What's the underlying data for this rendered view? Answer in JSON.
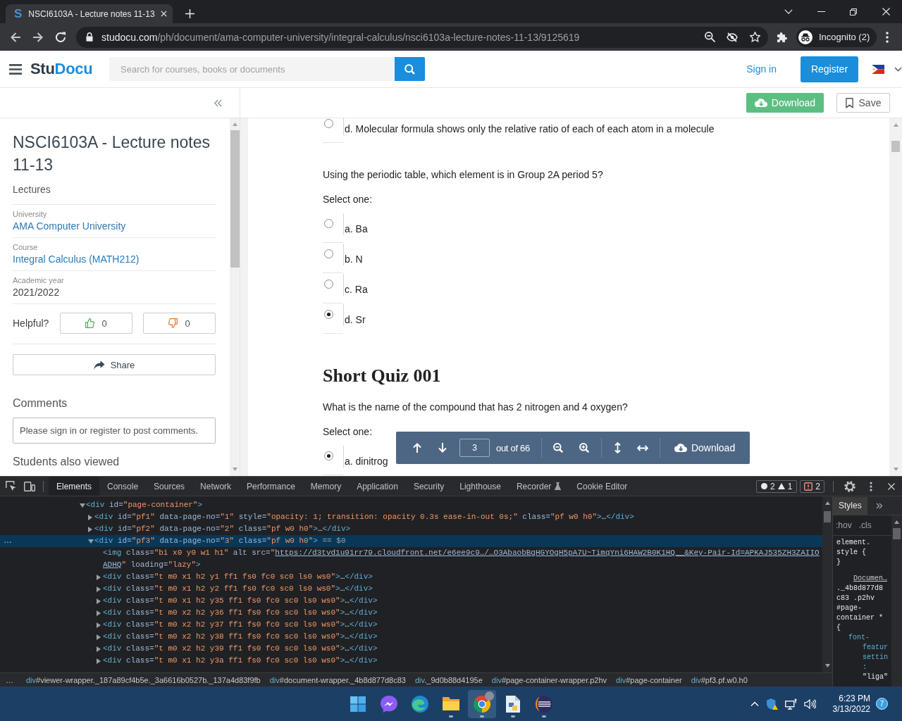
{
  "browser": {
    "tab": {
      "favicon": "S",
      "title": "NSCI6103A - Lecture notes 11-13",
      "selected": true
    },
    "url": {
      "host": "studocu.com",
      "path": "/ph/document/ama-computer-university/integral-calculus/nsci6103a-lecture-notes-11-13/9125619"
    },
    "profile": {
      "label": "Incognito (2)"
    }
  },
  "site_header": {
    "logo": {
      "text": "Stu",
      "highlight": "Docu"
    },
    "search": {
      "placeholder": "Search for courses, books or documents"
    },
    "sign_in": "Sign in",
    "register": "Register"
  },
  "action_bar": {
    "download": "Download",
    "save": "Save"
  },
  "sidebar": {
    "title": "NSCI6103A - Lecture notes 11-13",
    "category": "Lectures",
    "details": [
      {
        "label": "University",
        "value": "AMA Computer University",
        "kind": "link"
      },
      {
        "label": "Course",
        "value": "Integral Calculus (MATH212)",
        "kind": "link"
      },
      {
        "label": "Academic year",
        "value": "2021/2022",
        "kind": "text"
      }
    ],
    "helpful": {
      "label": "Helpful?",
      "votes": [
        {
          "kind": "up",
          "count": "0"
        },
        {
          "kind": "down",
          "count": "0"
        }
      ]
    },
    "share": "Share",
    "comments": {
      "heading": "Comments",
      "notice": "Please sign in or register to post comments."
    },
    "related_heading": "Students also viewed"
  },
  "document": {
    "items": [
      {
        "kind": "option",
        "label": "d. Molecular formula shows only the relative ratio of each of each atom in a molecule",
        "selected": false
      },
      {
        "kind": "question",
        "text": "Using the periodic table, which element is in Group 2A period 5?"
      },
      {
        "kind": "prompt",
        "text": "Select one:"
      },
      {
        "kind": "option",
        "label": "a. Ba",
        "selected": false
      },
      {
        "kind": "option",
        "label": "b. N",
        "selected": false
      },
      {
        "kind": "option",
        "label": "c. Ra",
        "selected": false
      },
      {
        "kind": "option",
        "label": "d. Sr",
        "selected": true
      },
      {
        "kind": "heading",
        "text": "Short Quiz 001"
      },
      {
        "kind": "question",
        "text": "What is the name of the compound that has 2 nitrogen and 4 oxygen?"
      },
      {
        "kind": "prompt",
        "text": "Select one:"
      },
      {
        "kind": "option",
        "label": "a. dinitrog",
        "selected": true
      }
    ]
  },
  "viewer_toolbar": {
    "page": "3",
    "total": "out of 66",
    "download": "Download"
  },
  "devtools": {
    "tabs": [
      {
        "label": "Elements",
        "selected": true,
        "kind": "panel"
      },
      {
        "label": "Console",
        "selected": false,
        "kind": "panel"
      },
      {
        "label": "Sources",
        "selected": false,
        "kind": "panel"
      },
      {
        "label": "Network",
        "selected": false,
        "kind": "panel"
      },
      {
        "label": "Performance",
        "selected": false,
        "kind": "panel"
      },
      {
        "label": "Memory",
        "selected": false,
        "kind": "panel"
      },
      {
        "label": "Application",
        "selected": false,
        "kind": "panel"
      },
      {
        "label": "Security",
        "selected": false,
        "kind": "panel"
      },
      {
        "label": "Lighthouse",
        "selected": false,
        "kind": "panel"
      },
      {
        "label": "Recorder",
        "selected": false,
        "kind": "preview"
      },
      {
        "label": "Cookie Editor",
        "selected": false,
        "kind": "panel"
      }
    ],
    "counters": [
      {
        "kind": "error",
        "count": "2"
      },
      {
        "kind": "warning",
        "count": "1"
      }
    ],
    "issues": "2",
    "tree": [
      {
        "kind": "parent",
        "expanded": true,
        "selected": false,
        "tokens": [
          {
            "kind": "tag",
            "text": "<div"
          },
          {
            "kind": "attr",
            "text": " id="
          },
          {
            "kind": "value",
            "text": "\"page-container\""
          },
          {
            "kind": "tag",
            "text": ">"
          }
        ],
        "children": [
          {
            "kind": "parent",
            "expanded": false,
            "selected": false,
            "tokens": [
              {
                "kind": "tag",
                "text": "<div"
              },
              {
                "kind": "attr",
                "text": " id="
              },
              {
                "kind": "value",
                "text": "\"pf1\""
              },
              {
                "kind": "attr",
                "text": " data-page-no="
              },
              {
                "kind": "value",
                "text": "\"1\""
              },
              {
                "kind": "attr",
                "text": " style="
              },
              {
                "kind": "value",
                "text": "\"opacity: 1; transition: opacity 0.3s ease-in-out 0s;\""
              },
              {
                "kind": "attr",
                "text": " class="
              },
              {
                "kind": "value",
                "text": "\"pf w0 h0\""
              },
              {
                "kind": "tag",
                "text": ">"
              },
              {
                "kind": "plain",
                "text": "…"
              },
              {
                "kind": "tag",
                "text": "</div>"
              }
            ]
          },
          {
            "kind": "parent",
            "expanded": false,
            "selected": false,
            "tokens": [
              {
                "kind": "tag",
                "text": "<div"
              },
              {
                "kind": "attr",
                "text": " id="
              },
              {
                "kind": "value",
                "text": "\"pf2\""
              },
              {
                "kind": "attr",
                "text": " data-page-no="
              },
              {
                "kind": "value",
                "text": "\"2\""
              },
              {
                "kind": "attr",
                "text": " class="
              },
              {
                "kind": "value",
                "text": "\"pf w0 h0\""
              },
              {
                "kind": "tag",
                "text": ">"
              },
              {
                "kind": "plain",
                "text": "…"
              },
              {
                "kind": "tag",
                "text": "</div>"
              }
            ]
          },
          {
            "kind": "parent",
            "expanded": true,
            "selected": true,
            "marker": "…",
            "tokens": [
              {
                "kind": "tag",
                "text": "<div"
              },
              {
                "kind": "attr",
                "text": " id="
              },
              {
                "kind": "value",
                "text": "\"pf3\""
              },
              {
                "kind": "attr",
                "text": " data-page-no="
              },
              {
                "kind": "value",
                "text": "\"3\""
              },
              {
                "kind": "attr",
                "text": " class="
              },
              {
                "kind": "value",
                "text": "\"pf w0 h0\""
              },
              {
                "kind": "tag",
                "text": ">"
              },
              {
                "kind": "note",
                "text": " == $0"
              }
            ],
            "children": [
              {
                "kind": "leaf",
                "selected": false,
                "tokens": [
                  {
                    "kind": "tag",
                    "text": "<img"
                  },
                  {
                    "kind": "attr",
                    "text": " class="
                  },
                  {
                    "kind": "value",
                    "text": "\"bi x0 y0 w1 h1\""
                  },
                  {
                    "kind": "attr",
                    "text": " alt src="
                  },
                  {
                    "kind": "value",
                    "text": "\""
                  },
                  {
                    "kind": "link",
                    "text": "https://d3tvd1u91rr79.cloudfront.net/e6ee9c9…/…O3AbaobBgHGYOgH5pA7U~TimqYni6HAW2B0K1HQ__&Key-Pair-Id=APKAJ535ZH3ZAIIOADHQ"
                  },
                  {
                    "kind": "value",
                    "text": "\""
                  },
                  {
                    "kind": "attr",
                    "text": " loading="
                  },
                  {
                    "kind": "value",
                    "text": "\"lazy\""
                  },
                  {
                    "kind": "tag",
                    "text": ">"
                  }
                ]
              },
              {
                "kind": "parent",
                "expanded": false,
                "selected": false,
                "tokens": [
                  {
                    "kind": "tag",
                    "text": "<div"
                  },
                  {
                    "kind": "attr",
                    "text": " class="
                  },
                  {
                    "kind": "value",
                    "text": "\"t m0 x1 h2 y1 ff1 fs0 fc0 sc0 ls0 ws0\""
                  },
                  {
                    "kind": "tag",
                    "text": ">"
                  },
                  {
                    "kind": "plain",
                    "text": "…"
                  },
                  {
                    "kind": "tag",
                    "text": "</div>"
                  }
                ]
              },
              {
                "kind": "parent",
                "expanded": false,
                "selected": false,
                "tokens": [
                  {
                    "kind": "tag",
                    "text": "<div"
                  },
                  {
                    "kind": "attr",
                    "text": " class="
                  },
                  {
                    "kind": "value",
                    "text": "\"t m0 x1 h2 y2 ff1 fs0 fc0 sc0 ls0 ws0\""
                  },
                  {
                    "kind": "tag",
                    "text": ">"
                  },
                  {
                    "kind": "plain",
                    "text": "…"
                  },
                  {
                    "kind": "tag",
                    "text": "</div>"
                  }
                ]
              },
              {
                "kind": "parent",
                "expanded": false,
                "selected": false,
                "tokens": [
                  {
                    "kind": "tag",
                    "text": "<div"
                  },
                  {
                    "kind": "attr",
                    "text": " class="
                  },
                  {
                    "kind": "value",
                    "text": "\"t m0 x1 h2 y35 ff1 fs0 fc0 sc0 ls0 ws0\""
                  },
                  {
                    "kind": "tag",
                    "text": ">"
                  },
                  {
                    "kind": "plain",
                    "text": "…"
                  },
                  {
                    "kind": "tag",
                    "text": "</div>"
                  }
                ]
              },
              {
                "kind": "parent",
                "expanded": false,
                "selected": false,
                "tokens": [
                  {
                    "kind": "tag",
                    "text": "<div"
                  },
                  {
                    "kind": "attr",
                    "text": " class="
                  },
                  {
                    "kind": "value",
                    "text": "\"t m0 x2 h2 y36 ff1 fs0 fc0 sc0 ls0 ws0\""
                  },
                  {
                    "kind": "tag",
                    "text": ">"
                  },
                  {
                    "kind": "plain",
                    "text": "…"
                  },
                  {
                    "kind": "tag",
                    "text": "</div>"
                  }
                ]
              },
              {
                "kind": "parent",
                "expanded": false,
                "selected": false,
                "tokens": [
                  {
                    "kind": "tag",
                    "text": "<div"
                  },
                  {
                    "kind": "attr",
                    "text": " class="
                  },
                  {
                    "kind": "value",
                    "text": "\"t m0 x2 h2 y37 ff1 fs0 fc0 sc0 ls0 ws0\""
                  },
                  {
                    "kind": "tag",
                    "text": ">"
                  },
                  {
                    "kind": "plain",
                    "text": "…"
                  },
                  {
                    "kind": "tag",
                    "text": "</div>"
                  }
                ]
              },
              {
                "kind": "parent",
                "expanded": false,
                "selected": false,
                "tokens": [
                  {
                    "kind": "tag",
                    "text": "<div"
                  },
                  {
                    "kind": "attr",
                    "text": " class="
                  },
                  {
                    "kind": "value",
                    "text": "\"t m0 x2 h2 y38 ff1 fs0 fc0 sc0 ls0 ws0\""
                  },
                  {
                    "kind": "tag",
                    "text": ">"
                  },
                  {
                    "kind": "plain",
                    "text": "…"
                  },
                  {
                    "kind": "tag",
                    "text": "</div>"
                  }
                ]
              },
              {
                "kind": "parent",
                "expanded": false,
                "selected": false,
                "tokens": [
                  {
                    "kind": "tag",
                    "text": "<div"
                  },
                  {
                    "kind": "attr",
                    "text": " class="
                  },
                  {
                    "kind": "value",
                    "text": "\"t m0 x2 h2 y39 ff1 fs0 fc0 sc0 ls0 ws0\""
                  },
                  {
                    "kind": "tag",
                    "text": ">"
                  },
                  {
                    "kind": "plain",
                    "text": "…"
                  },
                  {
                    "kind": "tag",
                    "text": "</div>"
                  }
                ]
              },
              {
                "kind": "parent",
                "expanded": false,
                "selected": false,
                "tokens": [
                  {
                    "kind": "tag",
                    "text": "<div"
                  },
                  {
                    "kind": "attr",
                    "text": " class="
                  },
                  {
                    "kind": "value",
                    "text": "\"t m0 x1 h2 y3a ff1 fs0 fc0 sc0 ls0 ws0\""
                  },
                  {
                    "kind": "tag",
                    "text": ">"
                  },
                  {
                    "kind": "plain",
                    "text": "…"
                  },
                  {
                    "kind": "tag",
                    "text": "</div>"
                  }
                ]
              }
            ]
          }
        ]
      }
    ],
    "breadcrumbs": {
      "overflow": "…",
      "items": [
        {
          "tag": "div",
          "rest": "#viewer-wrapper._187a89cf4b5e._3a6616b0527b._137a4d83f9fb"
        },
        {
          "tag": "div",
          "rest": "#document-wrapper._4b8d877d8c83"
        },
        {
          "tag": "div",
          "rest": "._9d0b88d4195e"
        },
        {
          "tag": "div",
          "rest": "#page-container-wrapper.p2hv"
        },
        {
          "tag": "div",
          "rest": "#page-container"
        },
        {
          "tag": "div",
          "rest": "#pf3.pf.w0.h0"
        }
      ]
    },
    "styles": {
      "tabs": [
        {
          "label": "Styles",
          "selected": true
        }
      ],
      "toggles": [
        ":hov",
        ".cls"
      ],
      "lines": [
        {
          "kind": "selector",
          "text": "element."
        },
        {
          "kind": "selector",
          "text": "style {"
        },
        {
          "kind": "brace",
          "text": "}"
        },
        {
          "kind": "source",
          "text": "Documen…"
        },
        {
          "kind": "selector",
          "text": "._4b8d877d8"
        },
        {
          "kind": "selector",
          "text": "c83 .p2hv"
        },
        {
          "kind": "selector",
          "text": "#page-"
        },
        {
          "kind": "selector",
          "text": "container *"
        },
        {
          "kind": "brace",
          "text": "{"
        },
        {
          "kind": "property",
          "text": "font-"
        },
        {
          "kind": "property-wrap",
          "text": "featur"
        },
        {
          "kind": "property-wrap",
          "text": "settin"
        },
        {
          "kind": "property-wrap",
          "text": ":"
        },
        {
          "kind": "value",
          "text": "\"liga\""
        }
      ]
    }
  },
  "taskbar": {
    "apps": [
      {
        "kind": "start",
        "running": false,
        "selected": false
      },
      {
        "kind": "messenger",
        "running": false,
        "selected": false
      },
      {
        "kind": "edge",
        "running": false,
        "selected": false
      },
      {
        "kind": "explorer",
        "running": true,
        "selected": false
      },
      {
        "kind": "chrome",
        "running": true,
        "selected": true
      },
      {
        "kind": "python",
        "running": true,
        "selected": false
      },
      {
        "kind": "eclipse",
        "running": true,
        "selected": false
      }
    ],
    "tray": [
      {
        "kind": "chevron"
      },
      {
        "kind": "shield"
      },
      {
        "kind": "network"
      },
      {
        "kind": "volume"
      }
    ],
    "clock": {
      "time": "6:23 PM",
      "date": "3/13/2022"
    },
    "notifications": "7"
  }
}
